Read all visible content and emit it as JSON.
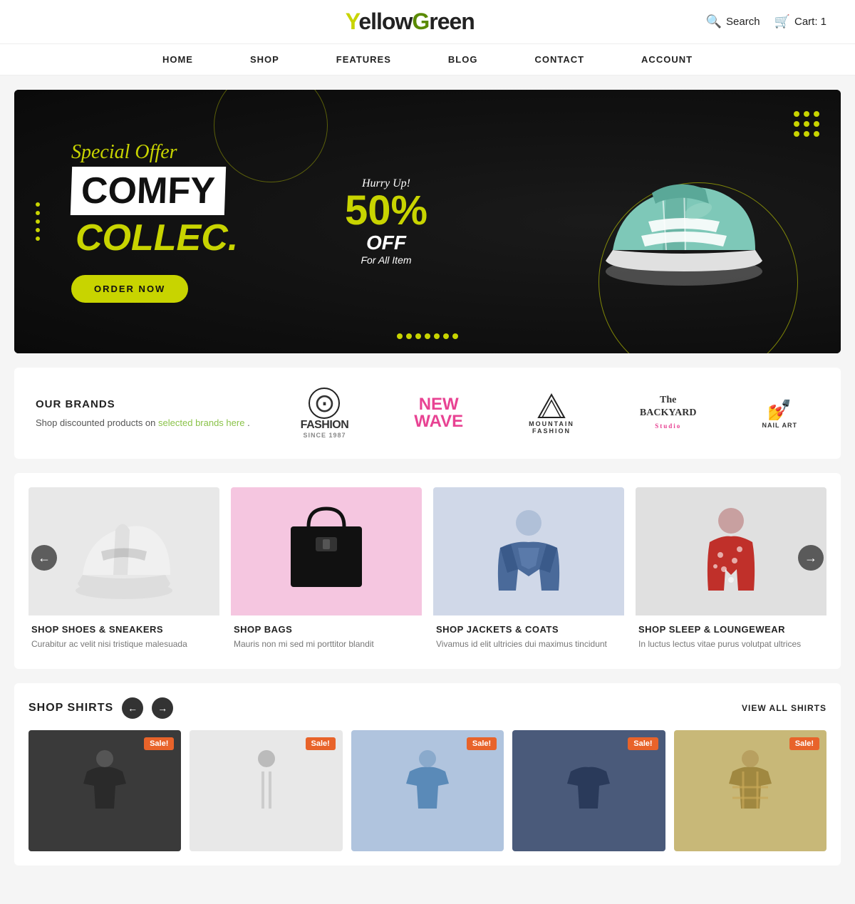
{
  "header": {
    "logo": {
      "y": "Y",
      "ellow": "ellow",
      "g": "G",
      "reen": "reen"
    },
    "search_label": "Search",
    "cart_label": "Cart: 1"
  },
  "nav": {
    "items": [
      {
        "label": "HOME",
        "id": "home"
      },
      {
        "label": "SHOP",
        "id": "shop"
      },
      {
        "label": "FEATURES",
        "id": "features"
      },
      {
        "label": "BLOG",
        "id": "blog"
      },
      {
        "label": "CONTACT",
        "id": "contact"
      },
      {
        "label": "ACCOUNT",
        "id": "account"
      }
    ]
  },
  "hero": {
    "special_offer": "Special Offer",
    "title_white": "COMFY",
    "title_yellow": "COLLEC.",
    "hurry": "Hurry Up!",
    "discount": "50%",
    "off": "OFF",
    "for_all": "For All Item",
    "order_btn": "ORDER NOW"
  },
  "brands": {
    "heading": "OUR BRANDS",
    "description": "Shop discounted products on",
    "link_text": "selected brands here",
    "link_suffix": " .",
    "items": [
      {
        "name": "FASHION",
        "sub": "SINCE 1987",
        "icon": "⊙"
      },
      {
        "name": "NEW WAVE",
        "sub": "",
        "icon": "★"
      },
      {
        "name": "MOUNTAIN FASHION",
        "sub": "",
        "icon": "◇"
      },
      {
        "name": "The BACKYARD Studio",
        "sub": "",
        "icon": "▢"
      },
      {
        "name": "NAIL ART",
        "sub": "",
        "icon": "✿"
      }
    ]
  },
  "categories": {
    "items": [
      {
        "title": "SHOP SHOES & SNEAKERS",
        "description": "Curabitur ac velit nisi tristique malesuada",
        "bg": "shoes-bg",
        "icon": "👟"
      },
      {
        "title": "SHOP BAGS",
        "description": "Mauris non mi sed mi porttitor blandit",
        "bg": "bags-bg",
        "icon": "👜"
      },
      {
        "title": "SHOP JACKETS & COATS",
        "description": "Vivamus id elit ultricies dui maximus tincidunt",
        "bg": "jackets-bg",
        "icon": "🧥"
      },
      {
        "title": "SHOP SLEEP & LOUNGEWEAR",
        "description": "In luctus lectus vitae purus volutpat ultrices",
        "bg": "loungewear-bg",
        "icon": "👗"
      }
    ],
    "prev_label": "←",
    "next_label": "→"
  },
  "shirts": {
    "heading": "SHOP SHIRTS",
    "view_all": "VIEW ALL SHIRTS",
    "prev_label": "←",
    "next_label": "→",
    "items": [
      {
        "bg": "dark-bg",
        "icon": "👕",
        "sale": "Sale!"
      },
      {
        "bg": "light-bg",
        "icon": "👕",
        "sale": "Sale!"
      },
      {
        "bg": "blue-bg",
        "icon": "👕",
        "sale": "Sale!"
      },
      {
        "bg": "navy-bg",
        "icon": "👕",
        "sale": "Sale!"
      },
      {
        "bg": "plaid-bg",
        "icon": "👕",
        "sale": "Sale!"
      }
    ]
  }
}
